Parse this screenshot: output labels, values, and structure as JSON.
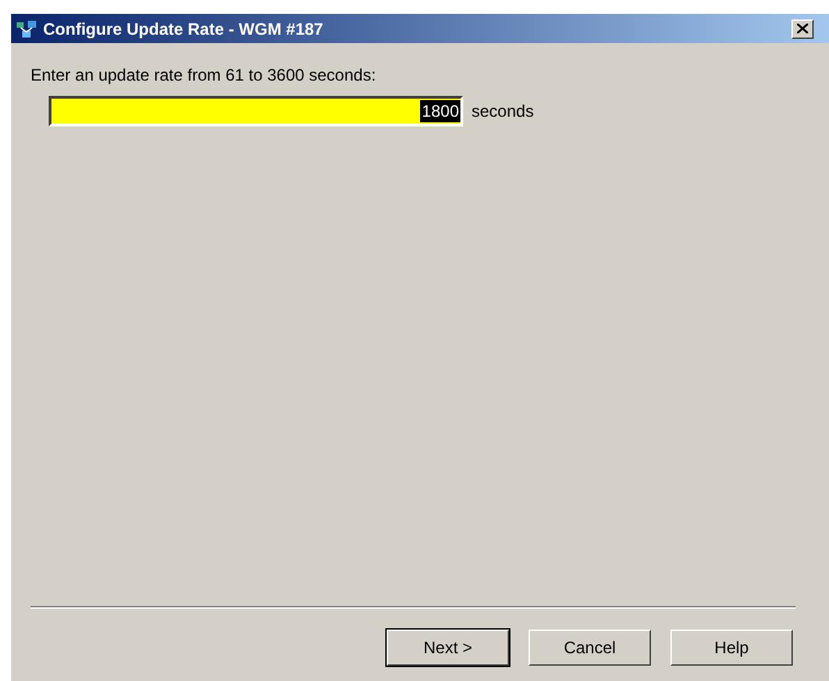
{
  "window": {
    "title": "Configure Update Rate - WGM #187"
  },
  "prompt": "Enter an update rate from 61 to 3600 seconds:",
  "rate_field": {
    "value": "1800",
    "text_selected": true
  },
  "unit": "seconds",
  "buttons": [
    {
      "label": "Next >",
      "default": true
    },
    {
      "label": "Cancel",
      "default": false
    },
    {
      "label": "Help",
      "default": false
    }
  ]
}
